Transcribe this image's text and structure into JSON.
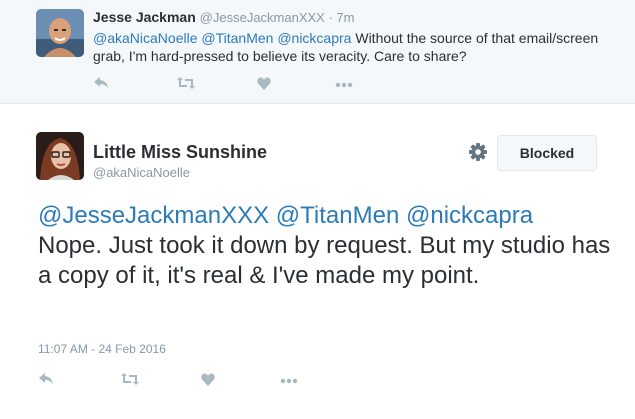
{
  "reply": {
    "name": "Jesse Jackman",
    "handle": "@JesseJackmanXXX",
    "separator": " · ",
    "time": "7m",
    "mentions": [
      "@akaNicaNoelle",
      "@TitanMen",
      "@nickcapra"
    ],
    "text": " Without the source of that email/screen grab, I'm hard-pressed to believe its veracity. Care to share?",
    "actions": [
      "reply-icon",
      "retweet-icon",
      "like-icon",
      "more-icon"
    ]
  },
  "tweet": {
    "name": "Little Miss Sunshine",
    "handle": "@akaNicaNoelle",
    "follow_state": "Blocked",
    "mentions": [
      "@JesseJackmanXXX",
      "@TitanMen",
      "@nickcapra"
    ],
    "text": "Nope. Just took it down by request. But my studio has a copy of it, it's real & I've made my point.",
    "timestamp": "11:07 AM - 24 Feb 2016",
    "actions": [
      "reply-icon",
      "retweet-icon",
      "like-icon",
      "more-icon"
    ]
  },
  "colors": {
    "link": "#2b7bb9",
    "muted": "#8899a6",
    "icon": "#aab8c2",
    "reply_bg": "#f5f8fa",
    "border": "#e1e8ed"
  }
}
